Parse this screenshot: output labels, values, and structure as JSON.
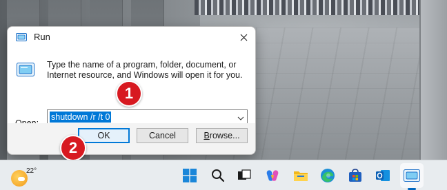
{
  "run_dialog": {
    "title": "Run",
    "description": "Type the name of a program, folder, document, or Internet resource, and Windows will open it for you.",
    "open_label_accel": "O",
    "open_label_rest": "pen:",
    "command_value": "shutdown /r /t 0",
    "buttons": {
      "ok": "OK",
      "cancel": "Cancel",
      "browse_accel": "B",
      "browse_rest": "rowse..."
    }
  },
  "step_markers": [
    "1",
    "2"
  ],
  "taskbar": {
    "weather_temp": "22°",
    "icons": [
      "windows-start-icon",
      "search-icon",
      "task-view-icon",
      "copilot-icon",
      "file-explorer-icon",
      "edge-icon",
      "microsoft-store-icon",
      "outlook-icon",
      "run-icon"
    ]
  },
  "colors": {
    "accent": "#0078d7",
    "marker_red": "#d71920",
    "selection": "#0078d7"
  }
}
